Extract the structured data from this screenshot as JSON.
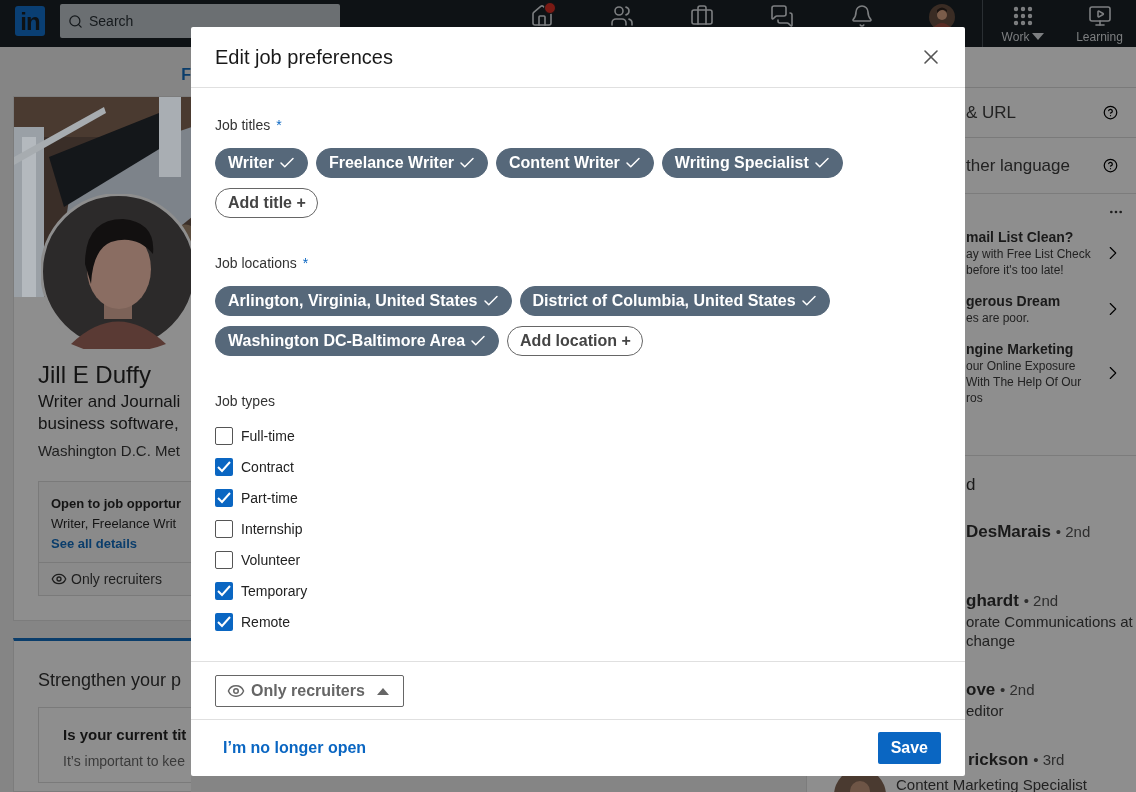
{
  "nav": {
    "logo": "in",
    "search": {
      "placeholder": "Search"
    },
    "items": [
      {
        "kind": "home",
        "notification": true
      },
      {
        "kind": "network",
        "notification": false
      },
      {
        "kind": "jobs",
        "notification": false
      },
      {
        "kind": "messaging",
        "notification": false
      },
      {
        "kind": "notifications",
        "notification": false
      },
      {
        "kind": "me",
        "notification": false
      }
    ],
    "work": {
      "label": "Work"
    },
    "learning": {
      "label": "Learning"
    }
  },
  "profile": {
    "top_link": "F",
    "name": "Jill E Duffy",
    "headline_lines": [
      "Writer and Journali",
      "business software,"
    ],
    "location": "Washington D.C. Met",
    "open_card": {
      "title": "Open to job opportur",
      "subtitle": "Writer, Freelance Writ",
      "link": "See all details",
      "visibility": "Only recruiters"
    },
    "strengthen": {
      "title": "Strengthen your p",
      "card_title": "Is your current tit",
      "card_text": "It’s important to kee"
    }
  },
  "sidebar": {
    "settings": [
      {
        "label": "& URL"
      },
      {
        "label": "ther language"
      }
    ],
    "ads": [
      {
        "title": "mail List Clean?",
        "lines": [
          "ay with Free List Check",
          "before it's too late!"
        ]
      },
      {
        "title": "gerous Dream",
        "lines": [
          "es are poor."
        ]
      },
      {
        "title": "ngine Marketing",
        "lines": [
          "our Online Exposure",
          "With The Help Of Our",
          "ros"
        ]
      }
    ],
    "people_heading": "d",
    "people": [
      {
        "kind": "cut",
        "name": "DesMarais",
        "degree": "• 2nd"
      },
      {
        "kind": "cut",
        "name": "ghardt",
        "degree": "• 2nd",
        "lines": [
          "orate Communications at",
          "change"
        ]
      },
      {
        "kind": "cut",
        "name": "ove",
        "degree": "• 2nd",
        "lines": [
          "editor"
        ]
      },
      {
        "kind": "full",
        "name": "rickson",
        "degree": "• 3rd",
        "lines": [
          "Content Marketing Specialist"
        ]
      }
    ]
  },
  "modal": {
    "title": "Edit job preferences",
    "job_titles": {
      "label": "Job titles",
      "marker": "*",
      "chips": [
        {
          "label": "Writer",
          "selected": true
        },
        {
          "label": "Freelance Writer",
          "selected": true
        },
        {
          "label": "Content Writer",
          "selected": true
        },
        {
          "label": "Writing Specialist",
          "selected": true
        }
      ],
      "add": "Add title +"
    },
    "job_locations": {
      "label": "Job locations",
      "marker": "*",
      "chips": [
        {
          "label": "Arlington, Virginia, United States",
          "selected": true
        },
        {
          "label": "District of Columbia, United States",
          "selected": true
        },
        {
          "label": "Washington DC-Baltimore Area",
          "selected": true
        }
      ],
      "add": "Add location +"
    },
    "job_types": {
      "label": "Job types",
      "options": [
        {
          "label": "Full-time",
          "checked": false
        },
        {
          "label": "Contract",
          "checked": true
        },
        {
          "label": "Part-time",
          "checked": true
        },
        {
          "label": "Internship",
          "checked": false
        },
        {
          "label": "Volunteer",
          "checked": false
        },
        {
          "label": "Temporary",
          "checked": true
        },
        {
          "label": "Remote",
          "checked": true
        }
      ]
    },
    "visibility": {
      "label": "Only recruiters",
      "expanded": true
    },
    "footer": {
      "link": "I’m no longer open",
      "save": "Save"
    }
  }
}
